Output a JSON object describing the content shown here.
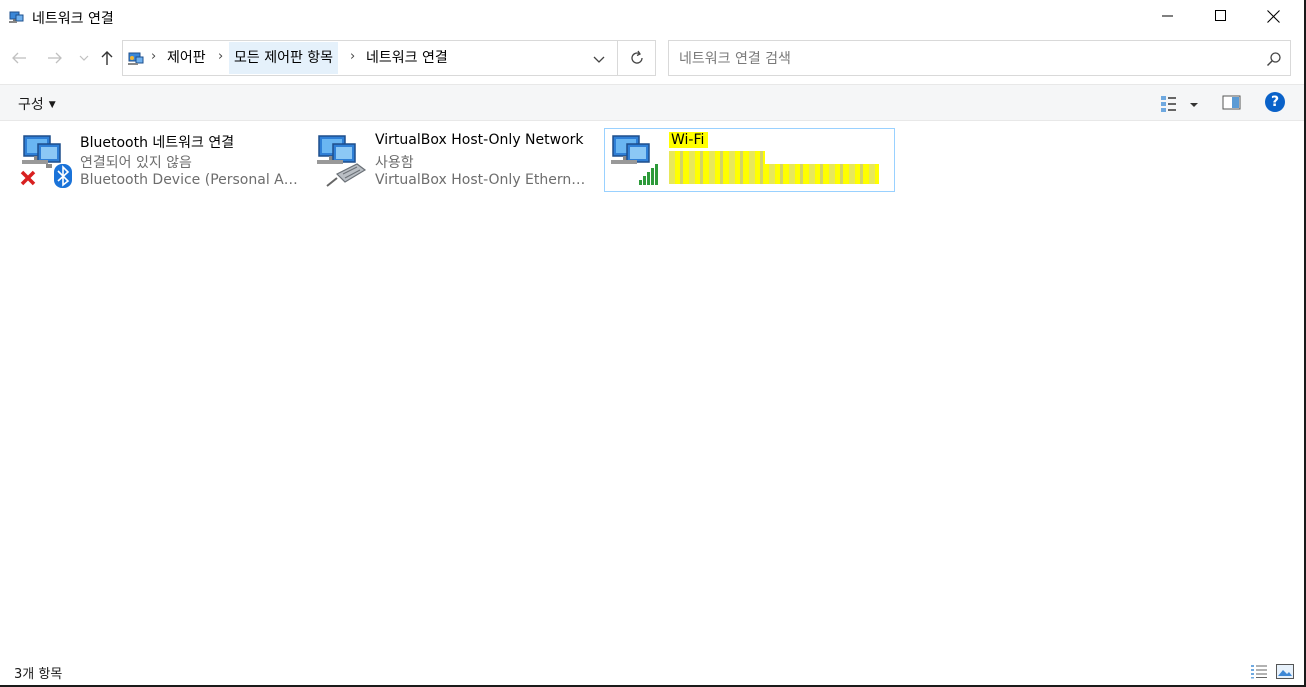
{
  "window": {
    "title": "네트워크 연결",
    "minimize_icon": "minimize-icon",
    "maximize_icon": "maximize-icon",
    "close_icon": "close-icon"
  },
  "nav": {
    "back_icon": "back-arrow-icon",
    "forward_icon": "forward-arrow-icon",
    "recent_icon": "chevron-down-icon",
    "up_icon": "up-arrow-icon"
  },
  "address": {
    "breadcrumbs": [
      "제어판",
      "모든 제어판 항목",
      "네트워크 연결"
    ],
    "separator": "›"
  },
  "search": {
    "placeholder": "네트워크 연결 검색",
    "value": ""
  },
  "toolbar": {
    "organize_label": "구성",
    "help_label": "?"
  },
  "connections": [
    {
      "name": "Bluetooth 네트워크 연결",
      "status": "연결되어 있지 않음",
      "device": "Bluetooth Device (Personal Area ...",
      "icon": "bluetooth-network-icon",
      "disconnected": true
    },
    {
      "name": "VirtualBox Host-Only Network",
      "status": "사용함",
      "device": "VirtualBox Host-Only Ethernet A...",
      "icon": "ethernet-network-icon",
      "disconnected": false
    },
    {
      "name": "Wi-Fi",
      "status": "",
      "device": "",
      "icon": "wifi-network-icon",
      "selected": true
    }
  ],
  "statusbar": {
    "item_count": "3개 항목"
  },
  "colors": {
    "accent": "#0a62c9",
    "selection_border": "#99d1ff",
    "highlight": "#ffff00",
    "breadcrumb_hover": "#e5f1fb"
  }
}
